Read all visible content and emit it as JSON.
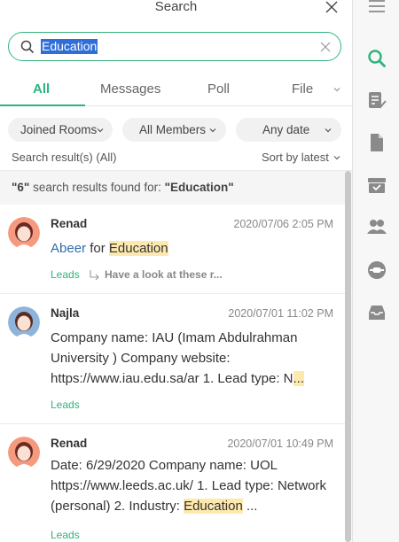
{
  "header": {
    "title": "Search"
  },
  "search": {
    "query": "Education"
  },
  "tabs": [
    {
      "label": "All"
    },
    {
      "label": "Messages"
    },
    {
      "label": "Poll"
    },
    {
      "label": "File"
    }
  ],
  "filters": {
    "rooms": "Joined Rooms",
    "members": "All Members",
    "date": "Any date"
  },
  "meta": {
    "result_label": "Search result(s) (All)",
    "sort_label": "Sort by latest"
  },
  "results": {
    "count": "\"6\"",
    "found_text": " search results found for: ",
    "term": "\"Education\""
  },
  "items": [
    {
      "sender": "Renad",
      "time": "2020/07/06 2:05 PM",
      "mention": "Abeer",
      "body_plain": " for ",
      "body_hl": "Education",
      "tag": "Leads",
      "reply": "Have a look at these r..."
    },
    {
      "sender": "Najla",
      "time": "2020/07/01 11:02 PM",
      "body_plain": "Company name: IAU (Imam Abdulrahman University ) Company website: https://www.iau.edu.sa/ar 1. Lead type: N",
      "body_hl": "...",
      "tag": "Leads"
    },
    {
      "sender": "Renad",
      "time": "2020/07/01 10:49 PM",
      "body_plain": "Date: 6/29/2020 Company name: UOL https://www.leeds.ac.uk/ 1. Lead type: Network (personal) 2. Industry: ",
      "body_hl": "Education",
      "body_tail": " ...",
      "tag": "Leads"
    }
  ],
  "colors": {
    "accent": "#2db37c",
    "highlight": "#fde9ae",
    "selection": "#2f6ed8"
  }
}
